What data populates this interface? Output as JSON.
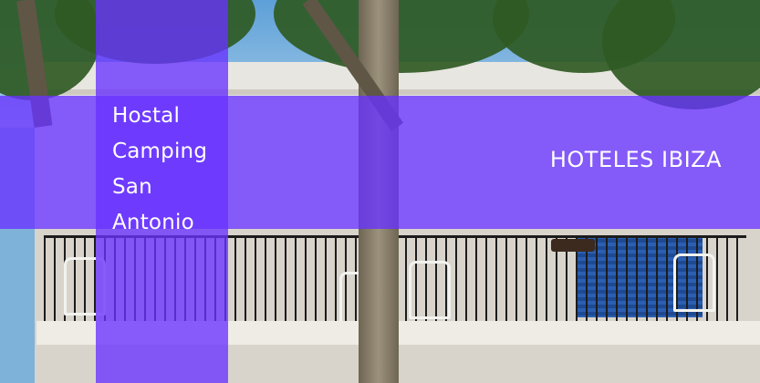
{
  "hotel_name_lines": [
    "Hostal",
    "Camping",
    "San",
    "Antonio"
  ],
  "category_label": "HOTELES IBIZA",
  "overlay_color": "#6832ff"
}
